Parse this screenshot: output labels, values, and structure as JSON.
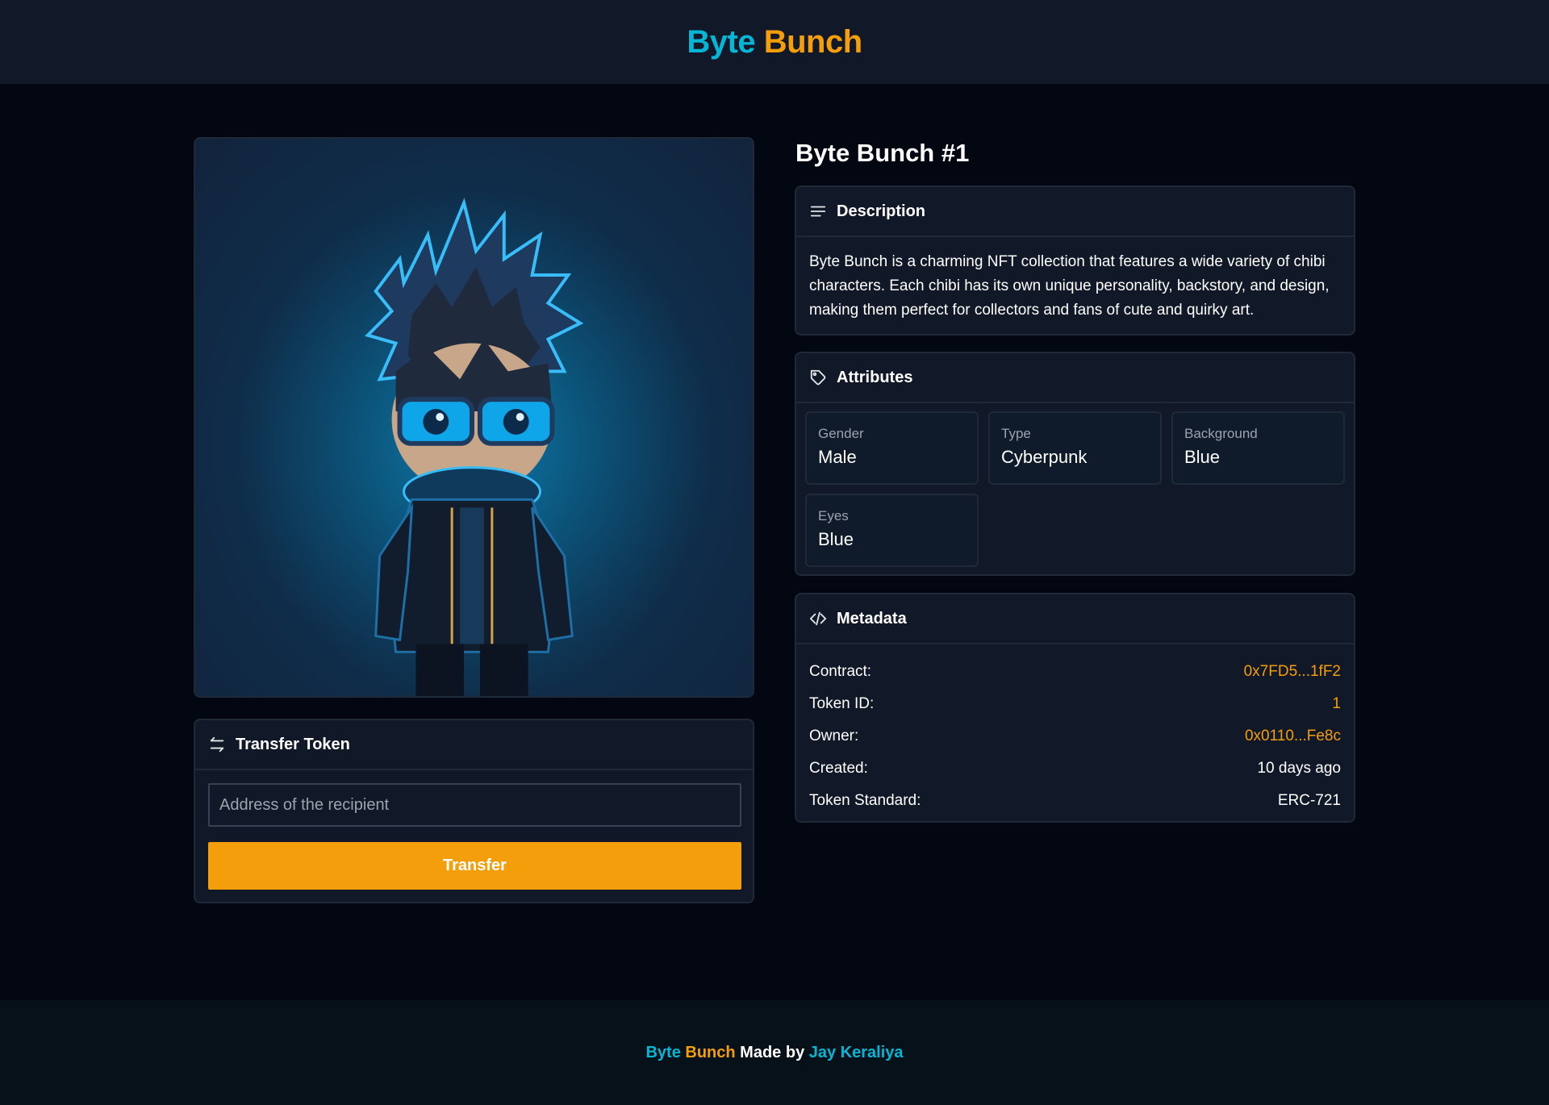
{
  "header": {
    "logo_byte": "Byte",
    "logo_bunch": "Bunch"
  },
  "nft": {
    "title": "Byte Bunch #1",
    "image_alt": "chibi-cyberpunk-boy"
  },
  "transfer": {
    "title": "Transfer Token",
    "icon": "arrows-exchange-icon",
    "input_placeholder": "Address of the recipient",
    "input_value": "",
    "button_label": "Transfer"
  },
  "description": {
    "title": "Description",
    "icon": "menu-lines-icon",
    "text": "Byte Bunch is a charming NFT collection that features a wide variety of chibi characters. Each chibi has its own unique personality, backstory, and design, making them perfect for collectors and fans of cute and quirky art."
  },
  "attributes": {
    "title": "Attributes",
    "icon": "tag-icon",
    "items": [
      {
        "label": "Gender",
        "value": "Male"
      },
      {
        "label": "Type",
        "value": "Cyberpunk"
      },
      {
        "label": "Background",
        "value": "Blue"
      },
      {
        "label": "Eyes",
        "value": "Blue"
      }
    ]
  },
  "metadata": {
    "title": "Metadata",
    "icon": "code-icon",
    "rows": [
      {
        "key": "Contract:",
        "value": "0x7FD5...1fF2",
        "accent": true
      },
      {
        "key": "Token ID:",
        "value": "1",
        "accent": true
      },
      {
        "key": "Owner:",
        "value": "0x0110...Fe8c",
        "accent": true
      },
      {
        "key": "Created:",
        "value": "10 days ago",
        "accent": false
      },
      {
        "key": "Token Standard:",
        "value": "ERC-721",
        "accent": false
      }
    ]
  },
  "footer": {
    "byte": "Byte",
    "bunch": "Bunch",
    "made_by": "Made by",
    "author": "Jay Keraliya"
  },
  "colors": {
    "cyan": "#06b6d4",
    "amber": "#f59e0b",
    "background": "#030712",
    "card": "#111827"
  }
}
